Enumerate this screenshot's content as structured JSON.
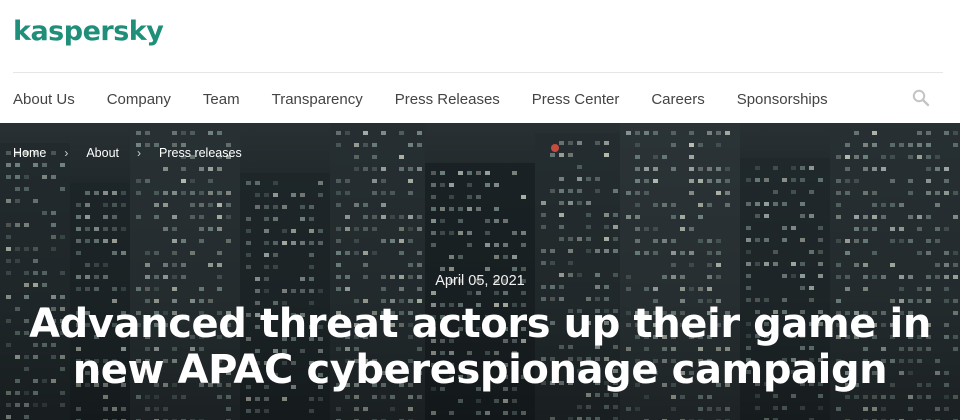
{
  "brand": {
    "logo_text": "kaspersky",
    "accent_color": "#1f8f79"
  },
  "nav": {
    "items": [
      {
        "label": "About Us"
      },
      {
        "label": "Company"
      },
      {
        "label": "Team"
      },
      {
        "label": "Transparency"
      },
      {
        "label": "Press Releases"
      },
      {
        "label": "Press Center"
      },
      {
        "label": "Careers"
      },
      {
        "label": "Sponsorships"
      }
    ],
    "search_icon": "search-icon"
  },
  "breadcrumb": {
    "items": [
      {
        "label": "Home"
      },
      {
        "label": "About"
      },
      {
        "label": "Press releases"
      }
    ],
    "separator": "›"
  },
  "article": {
    "date": "April 05, 2021",
    "title_line1": "Advanced threat actors up their game in",
    "title_line2": "new APAC cyberespionage campaign"
  }
}
